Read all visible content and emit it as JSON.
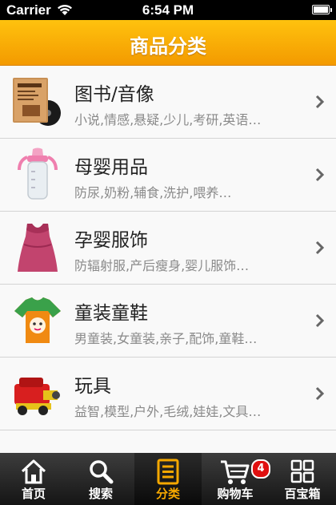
{
  "status_bar": {
    "carrier": "Carrier",
    "time": "6:54 PM"
  },
  "header": {
    "title": "商品分类"
  },
  "categories": [
    {
      "title": "图书/音像",
      "subtitle": "小说,情感,悬疑,少儿,考研,英语…",
      "icon": "book-icon"
    },
    {
      "title": "母婴用品",
      "subtitle": "防尿,奶粉,辅食,洗护,喂养…",
      "icon": "baby-bottle-icon"
    },
    {
      "title": "孕婴服饰",
      "subtitle": "防辐射服,产后瘦身,婴儿服饰…",
      "icon": "maternity-dress-icon"
    },
    {
      "title": "童装童鞋",
      "subtitle": "男童装,女童装,亲子,配饰,童鞋…",
      "icon": "kids-shirt-icon"
    },
    {
      "title": "玩具",
      "subtitle": "益智,模型,户外,毛绒,娃娃,文具…",
      "icon": "toy-car-icon"
    }
  ],
  "tabs": [
    {
      "label": "首页",
      "icon": "home-icon",
      "active": false
    },
    {
      "label": "搜索",
      "icon": "search-icon",
      "active": false
    },
    {
      "label": "分类",
      "icon": "category-list-icon",
      "active": true
    },
    {
      "label": "购物车",
      "icon": "cart-icon",
      "active": false,
      "badge": "4"
    },
    {
      "label": "百宝箱",
      "icon": "grid-icon",
      "active": false
    }
  ],
  "colors": {
    "header": "#f5a500",
    "active_tab": "#f6a800",
    "badge": "#e01010"
  }
}
